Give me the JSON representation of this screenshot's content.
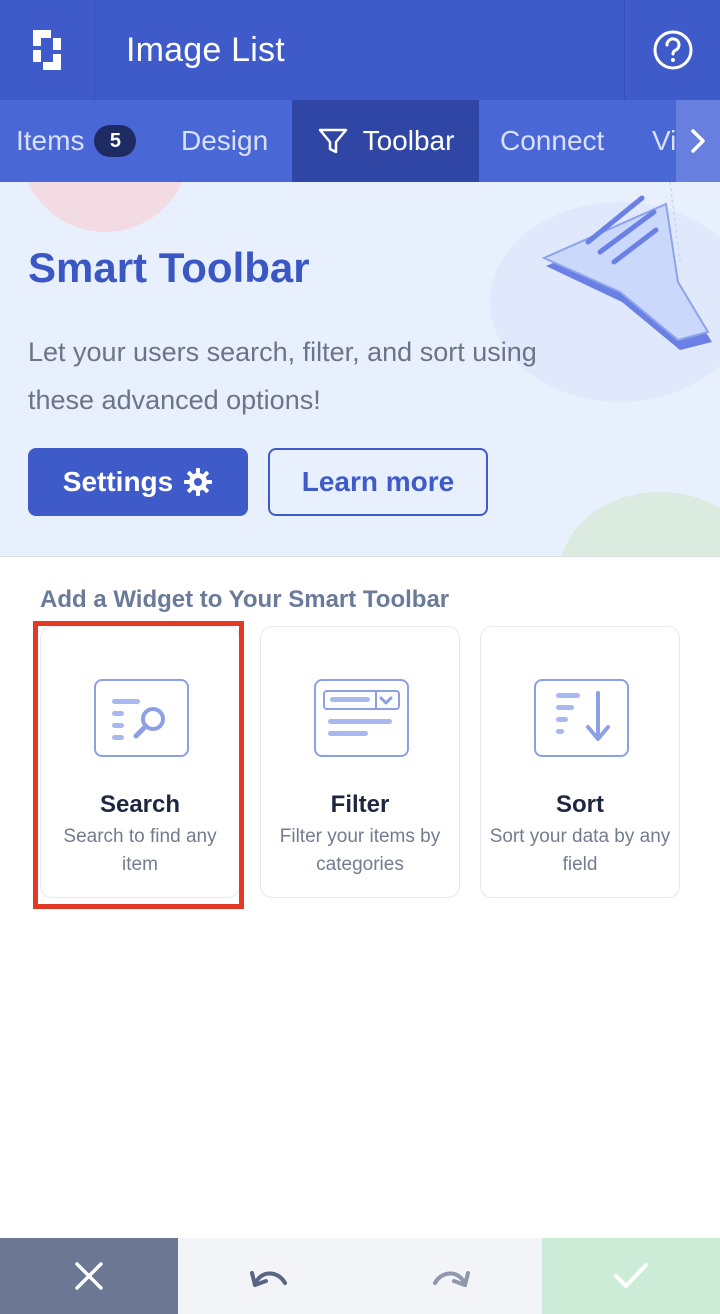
{
  "header": {
    "title": "Image List",
    "logo_icon": "logo-icon",
    "help_icon": "help-circle-icon"
  },
  "tabs": [
    {
      "label": "Items",
      "badge": "5",
      "active": false
    },
    {
      "label": "Design",
      "active": false
    },
    {
      "label": "Toolbar",
      "icon": "filter-icon",
      "active": true
    },
    {
      "label": "Connect",
      "active": false
    },
    {
      "label": "Vi",
      "active": false
    }
  ],
  "hero": {
    "title": "Smart Toolbar",
    "description": "Let your users search, filter, and sort using these advanced options!",
    "settings_label": "Settings",
    "learn_more_label": "Learn more"
  },
  "widgets": {
    "section_title": "Add a Widget to Your Smart Toolbar",
    "items": [
      {
        "title": "Search",
        "description": "Search to find any item",
        "icon": "search-widget-icon",
        "highlighted": true
      },
      {
        "title": "Filter",
        "description": "Filter your items by categories",
        "icon": "filter-widget-icon",
        "highlighted": false
      },
      {
        "title": "Sort",
        "description": "Sort your data by any field",
        "icon": "sort-widget-icon",
        "highlighted": false
      }
    ]
  },
  "bottom_bar": {
    "close_icon": "close-icon",
    "undo_icon": "undo-icon",
    "redo_icon": "redo-icon",
    "confirm_icon": "check-icon"
  },
  "colors": {
    "primary": "#3f5bc9",
    "tab_active": "#2f46a5",
    "highlight": "#e23a24"
  }
}
